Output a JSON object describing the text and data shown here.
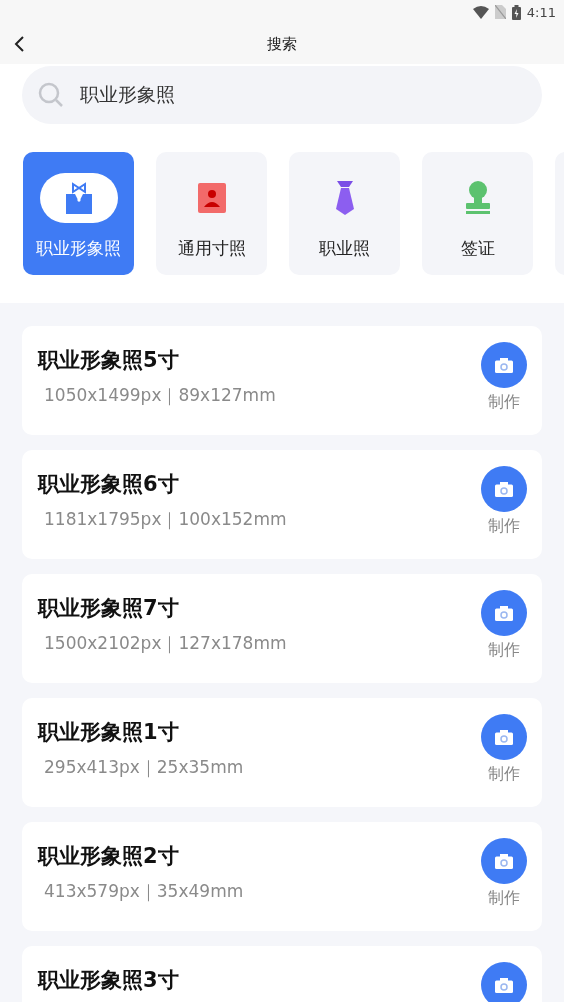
{
  "status_bar": {
    "time": "4:11"
  },
  "header": {
    "title": "搜索"
  },
  "search": {
    "value": "职业形象照"
  },
  "categories": [
    {
      "label": "职业形象照",
      "kind": "suit",
      "selected": true
    },
    {
      "label": "通用寸照",
      "kind": "portrait",
      "selected": false
    },
    {
      "label": "职业照",
      "kind": "tie",
      "selected": false
    },
    {
      "label": "签证",
      "kind": "stamp",
      "selected": false
    }
  ],
  "items": [
    {
      "title": "职业形象照5寸",
      "specs": "1050x1499px｜89x127mm",
      "action": "制作"
    },
    {
      "title": "职业形象照6寸",
      "specs": "1181x1795px｜100x152mm",
      "action": "制作"
    },
    {
      "title": "职业形象照7寸",
      "specs": "1500x2102px｜127x178mm",
      "action": "制作"
    },
    {
      "title": "职业形象照1寸",
      "specs": "295x413px｜25x35mm",
      "action": "制作"
    },
    {
      "title": "职业形象照2寸",
      "specs": "413x579px｜35x49mm",
      "action": "制作"
    },
    {
      "title": "职业形象照3寸"
    }
  ]
}
